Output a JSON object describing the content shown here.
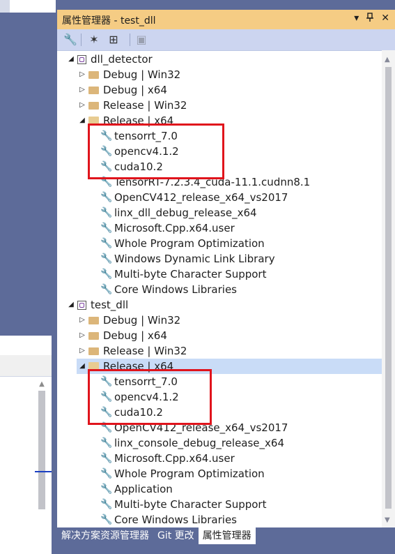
{
  "panel": {
    "title": "属性管理器 - test_dll",
    "controls": {
      "dropdown": "▾",
      "pin": "📌",
      "close": "✕"
    }
  },
  "toolbar": {
    "icons": [
      "wrench-icon",
      "magic-wand-icon",
      "add-property-sheet-icon",
      "save-icon"
    ]
  },
  "projects": [
    {
      "name": "dll_detector",
      "configs": [
        {
          "label": "Debug | Win32",
          "expanded": false
        },
        {
          "label": "Debug | x64",
          "expanded": false
        },
        {
          "label": "Release | Win32",
          "expanded": false
        },
        {
          "label": "Release | x64",
          "expanded": true,
          "sheets": [
            "tensorrt_7.0",
            "opencv4.1.2",
            "cuda10.2",
            "TensorRT-7.2.3.4_cuda-11.1.cudnn8.1",
            "OpenCV412_release_x64_vs2017",
            "linx_dll_debug_release_x64",
            "Microsoft.Cpp.x64.user",
            "Whole Program Optimization",
            "Windows Dynamic Link Library",
            "Multi-byte Character Support",
            "Core Windows Libraries"
          ]
        }
      ]
    },
    {
      "name": "test_dll",
      "configs": [
        {
          "label": "Debug | Win32",
          "expanded": false
        },
        {
          "label": "Debug | x64",
          "expanded": false
        },
        {
          "label": "Release | Win32",
          "expanded": false
        },
        {
          "label": "Release | x64",
          "expanded": true,
          "selected": true,
          "sheets": [
            "tensorrt_7.0",
            "opencv4.1.2",
            "cuda10.2",
            "OpenCV412_release_x64_vs2017",
            "linx_console_debug_release_x64",
            "Microsoft.Cpp.x64.user",
            "Whole Program Optimization",
            "Application",
            "Multi-byte Character Support",
            "Core Windows Libraries"
          ]
        }
      ]
    }
  ],
  "tabs": [
    {
      "label": "解决方案资源管理器",
      "active": false
    },
    {
      "label": "Git 更改",
      "active": false
    },
    {
      "label": "属性管理器",
      "active": true
    }
  ],
  "left_panel": {
    "header_icons": "▾ 📌 ✕"
  },
  "colors": {
    "title_bar": "#f5cc84",
    "toolbar": "#ccd5f0",
    "ide_background": "#5d6b99",
    "selection": "#c9dcf7",
    "highlight_box": "#e0141c"
  }
}
